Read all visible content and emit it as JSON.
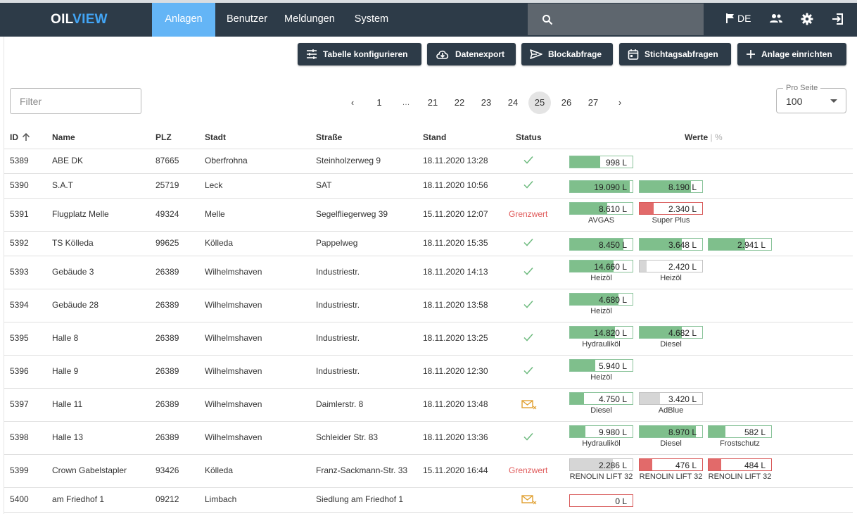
{
  "app": {
    "logo_part1": "OIL",
    "logo_part2": "VIEW"
  },
  "nav": [
    "Anlagen",
    "Benutzer",
    "Meldungen",
    "System"
  ],
  "search": {
    "placeholder": ""
  },
  "lang": "DE",
  "toolbar": {
    "configure": "Tabelle konfigurieren",
    "export": "Datenexport",
    "block": "Blockabfrage",
    "reference": "Stichtagsabfragen",
    "add": "Anlage einrichten"
  },
  "filter": {
    "placeholder": "Filter",
    "value": ""
  },
  "pagination": {
    "prev": "‹",
    "next": "›",
    "pages": [
      "1",
      "…",
      "21",
      "22",
      "23",
      "24",
      "25",
      "26",
      "27"
    ],
    "current": "25"
  },
  "per_page": {
    "label": "Pro Seite",
    "value": "100"
  },
  "columns": {
    "id": "ID",
    "name": "Name",
    "plz": "PLZ",
    "city": "Stadt",
    "street": "Straße",
    "stand": "Stand",
    "status": "Status",
    "values": "Werte",
    "values_sep": "|",
    "values_pct": "%"
  },
  "colors": {
    "ok": "#7fbf8c",
    "alarm": "#e26a6a",
    "neutral": "#d6d6d6",
    "status_check": "#6dba7e",
    "status_warn": "#e05a5a",
    "status_mail": "#e0a030",
    "accent": "#64b5f6",
    "header_bg": "#2d3b48"
  },
  "rows": [
    {
      "id": "5389",
      "name": "ABE DK",
      "plz": "87665",
      "city": "Oberfrohna",
      "street": "Steinholzerweg 9",
      "stand": "18.11.2020 13:28",
      "status": "ok",
      "status_text": "",
      "gauges": [
        {
          "value": "998 L",
          "fill": 0.48,
          "color": "green",
          "label": ""
        }
      ]
    },
    {
      "id": "5390",
      "name": "S.A.T",
      "plz": "25719",
      "city": "Leck",
      "street": "SAT",
      "stand": "18.11.2020 10:56",
      "status": "ok",
      "status_text": "",
      "gauges": [
        {
          "value": "19.090 L",
          "fill": 0.95,
          "color": "green",
          "label": ""
        },
        {
          "value": "8.190 L",
          "fill": 0.82,
          "color": "green",
          "label": ""
        }
      ]
    },
    {
      "id": "5391",
      "name": "Flugplatz Melle",
      "plz": "49324",
      "city": "Melle",
      "street": "Segelfliegerweg 39",
      "stand": "15.11.2020 12:07",
      "status": "warn",
      "status_text": "Grenzwert",
      "gauges": [
        {
          "value": "8.610 L",
          "fill": 0.6,
          "color": "green",
          "label": "AVGAS"
        },
        {
          "value": "2.340 L",
          "fill": 0.22,
          "color": "red",
          "label": "Super Plus"
        }
      ]
    },
    {
      "id": "5392",
      "name": "TS Kölleda",
      "plz": "99625",
      "city": "Kölleda",
      "street": "Pappelweg",
      "stand": "18.11.2020 15:35",
      "status": "ok",
      "status_text": "",
      "gauges": [
        {
          "value": "8.450 L",
          "fill": 0.85,
          "color": "green",
          "label": ""
        },
        {
          "value": "3.648 L",
          "fill": 0.67,
          "color": "green",
          "label": ""
        },
        {
          "value": "2.941 L",
          "fill": 0.58,
          "color": "green",
          "label": ""
        }
      ]
    },
    {
      "id": "5393",
      "name": "Gebäude 3",
      "plz": "26389",
      "city": "Wilhelmshaven",
      "street": "Industriestr.",
      "stand": "18.11.2020 14:13",
      "status": "ok",
      "status_text": "",
      "gauges": [
        {
          "value": "14.660 L",
          "fill": 0.7,
          "color": "green",
          "label": "Heizöl"
        },
        {
          "value": "2.420 L",
          "fill": 0.11,
          "color": "grey",
          "label": "Heizöl"
        }
      ]
    },
    {
      "id": "5394",
      "name": "Gebäude 28",
      "plz": "26389",
      "city": "Wilhelmshaven",
      "street": "Industriestr.",
      "stand": "18.11.2020 13:58",
      "status": "ok",
      "status_text": "",
      "gauges": [
        {
          "value": "4.680 L",
          "fill": 0.77,
          "color": "green",
          "label": "Heizöl"
        }
      ]
    },
    {
      "id": "5395",
      "name": "Halle 8",
      "plz": "26389",
      "city": "Wilhelmshaven",
      "street": "Industriestr.",
      "stand": "18.11.2020 13:25",
      "status": "ok",
      "status_text": "",
      "gauges": [
        {
          "value": "14.820 L",
          "fill": 0.72,
          "color": "green",
          "label": "Hydrauliköl"
        },
        {
          "value": "4.682 L",
          "fill": 0.67,
          "color": "green",
          "label": "Diesel"
        }
      ]
    },
    {
      "id": "5396",
      "name": "Halle 9",
      "plz": "26389",
      "city": "Wilhelmshaven",
      "street": "Industriestr.",
      "stand": "18.11.2020 12:30",
      "status": "ok",
      "status_text": "",
      "gauges": [
        {
          "value": "5.940 L",
          "fill": 0.4,
          "color": "green",
          "label": "Heizöl"
        }
      ]
    },
    {
      "id": "5397",
      "name": "Halle 11",
      "plz": "26389",
      "city": "Wilhelmshaven",
      "street": "Daimlerstr. 8",
      "stand": "18.11.2020 13:48",
      "status": "mail",
      "status_text": "",
      "gauges": [
        {
          "value": "4.750 L",
          "fill": 0.23,
          "color": "green",
          "label": "Diesel"
        },
        {
          "value": "3.420 L",
          "fill": 0.33,
          "color": "grey",
          "label": "AdBlue"
        }
      ]
    },
    {
      "id": "5398",
      "name": "Halle 13",
      "plz": "26389",
      "city": "Wilhelmshaven",
      "street": "Schleider Str. 83",
      "stand": "18.11.2020 13:36",
      "status": "ok",
      "status_text": "",
      "gauges": [
        {
          "value": "9.980 L",
          "fill": 0.25,
          "color": "green",
          "label": "Hydrauliköl"
        },
        {
          "value": "8.970 L",
          "fill": 0.9,
          "color": "green",
          "label": "Diesel"
        },
        {
          "value": "582 L",
          "fill": 0.27,
          "color": "green",
          "label": "Frostschutz"
        }
      ]
    },
    {
      "id": "5399",
      "name": "Crown Gabelstapler",
      "plz": "93426",
      "city": "Kölleda",
      "street": "Franz-Sackmann-Str. 33",
      "stand": "15.11.2020 16:44",
      "status": "warn",
      "status_text": "Grenzwert",
      "gauges": [
        {
          "value": "2.286 L",
          "fill": 0.68,
          "color": "grey",
          "label": "RENOLIN LIFT 32"
        },
        {
          "value": "476 L",
          "fill": 0.2,
          "color": "red",
          "label": "RENOLIN LIFT 32"
        },
        {
          "value": "484 L",
          "fill": 0.2,
          "color": "red",
          "label": "RENOLIN LIFT 32"
        }
      ]
    },
    {
      "id": "5400",
      "name": "am Friedhof 1",
      "plz": "09212",
      "city": "Limbach",
      "street": "Siedlung am Friedhof 1",
      "stand": "",
      "status": "mail",
      "status_text": "",
      "gauges": [
        {
          "value": "0 L",
          "fill": 0,
          "color": "red",
          "label": ""
        }
      ]
    }
  ]
}
